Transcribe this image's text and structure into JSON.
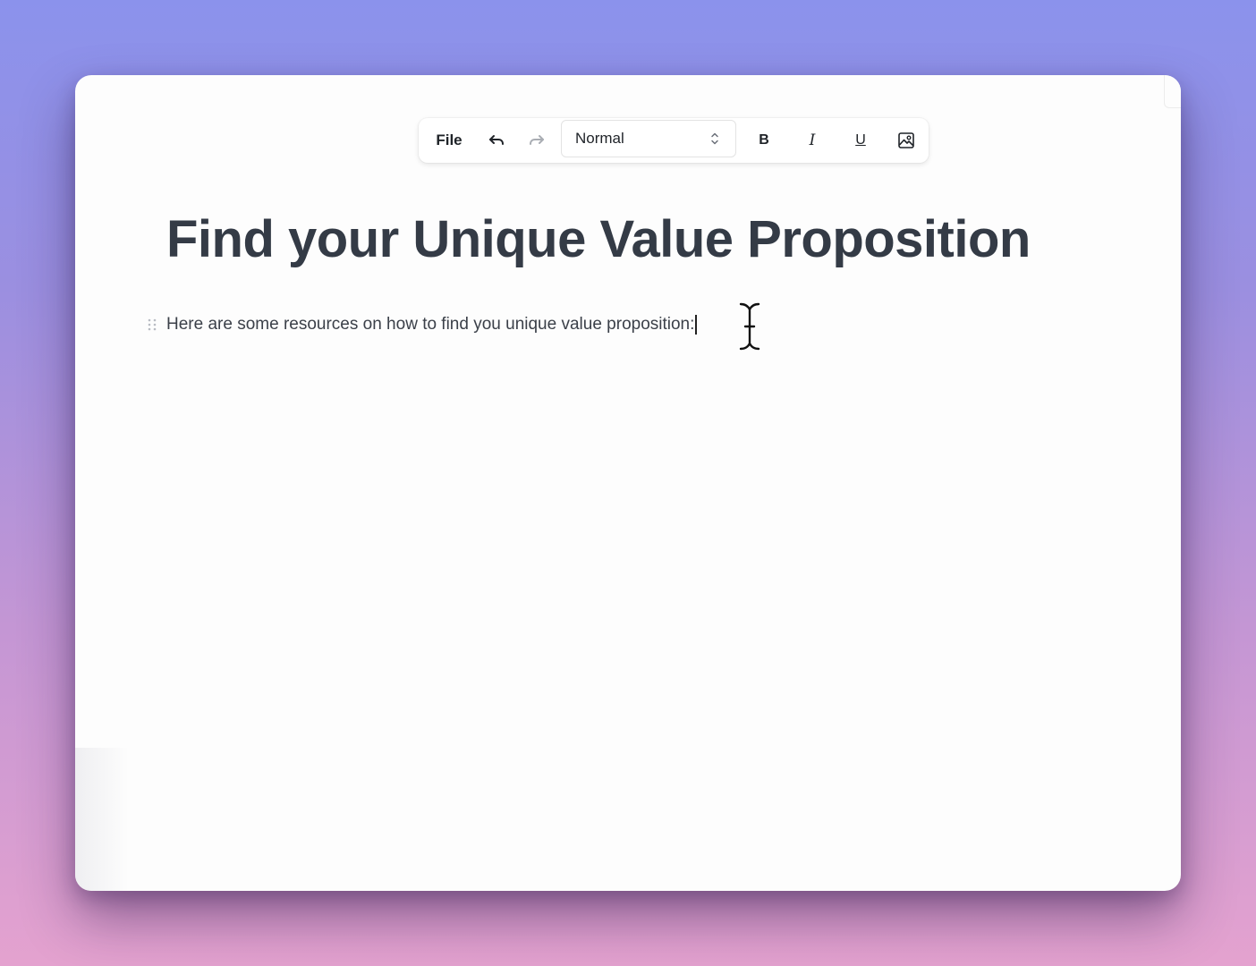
{
  "toolbar": {
    "file_label": "File",
    "undo_icon": "undo-icon",
    "redo_icon": "redo-icon",
    "block_type_value": "Normal",
    "bold_label": "B",
    "italic_label": "I",
    "underline_label": "U",
    "image_icon": "image-icon"
  },
  "document": {
    "title": "Find your Unique Value Proposition",
    "paragraph": "Here are some resources on how to find you unique value proposition:"
  },
  "colors": {
    "background_top": "#8b92ec",
    "background_bottom": "#e4a2cf",
    "title_text": "#343b46",
    "body_text": "#3b4049"
  }
}
